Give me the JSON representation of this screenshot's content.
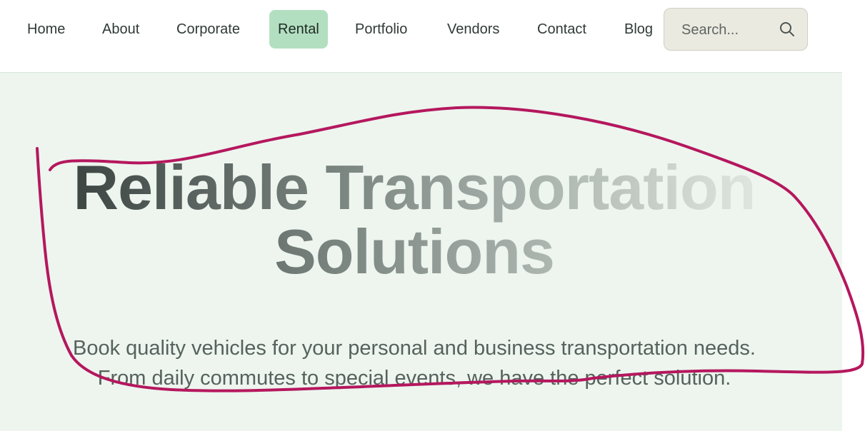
{
  "nav": {
    "items": [
      {
        "label": "Home"
      },
      {
        "label": "About"
      },
      {
        "label": "Corporate"
      },
      {
        "label": "Rental",
        "active": true
      },
      {
        "label": "Portfolio"
      },
      {
        "label": "Vendors"
      },
      {
        "label": "Contact"
      },
      {
        "label": "Blog"
      }
    ],
    "active_color": "#b3dfc1"
  },
  "search": {
    "placeholder": "Search...",
    "icon": "search-icon"
  },
  "hero": {
    "title_line1": "Reliable Transportation",
    "title_line2": "Solutions",
    "subtitle_line1": "Book quality vehicles for your personal and business transportation needs.",
    "subtitle_line2": "From daily commutes to special events, we have the perfect solution.",
    "background_color": "#edf5ee"
  },
  "annotation": {
    "type": "freehand-loop",
    "color": "#b5175e"
  }
}
